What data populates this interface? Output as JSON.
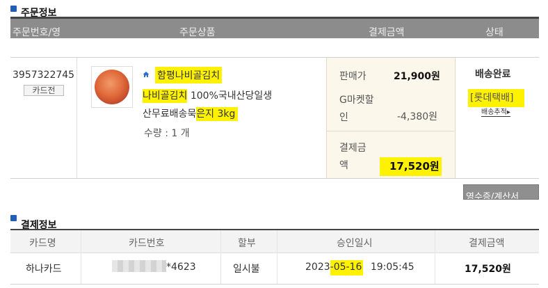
{
  "order_section": {
    "title": "주문정보",
    "headers": [
      "주문번호/영",
      "주문상품",
      "결제금액",
      "상태"
    ],
    "order_number": "3957322745",
    "card_button": "카드전",
    "product": {
      "seller": "함평나비골김치",
      "name_line1_hl": "나비골김치",
      "name_line1_rest": " 100%국내산당일생",
      "name_line2_a": "산무료배송묵",
      "name_line2_b": "은지 3kg",
      "quantity": "수량 : 1 개"
    },
    "price": {
      "sale_label": "판매가",
      "sale_value": "21,900원",
      "discount_label_1": "G마켓할",
      "discount_label_2": "인",
      "discount_value": "-4,380원",
      "pay_label_1": "결제금",
      "pay_label_2": "액",
      "pay_value": "17,520원"
    },
    "status": {
      "text": "배송완료",
      "courier": "[롯데택배]",
      "tracking": "배송추적"
    },
    "receipt_button": "영수증/계산서"
  },
  "payment_section": {
    "title": "결제정보",
    "headers": [
      "카드명",
      "카드번호",
      "할부",
      "승인일시",
      "결제금액"
    ],
    "row": {
      "card_name": "하나카드",
      "card_number": "*4623",
      "installment": "일시불",
      "date_a": "2023",
      "date_b": "-05-16",
      "time": "19:05:45",
      "amount": "17,520원"
    }
  },
  "colors": {
    "highlight": "#fff200",
    "header_bg": "#8c8c8c",
    "section_icon": "#1f5fb4",
    "price_panel_bg": "#fbf7ea"
  }
}
